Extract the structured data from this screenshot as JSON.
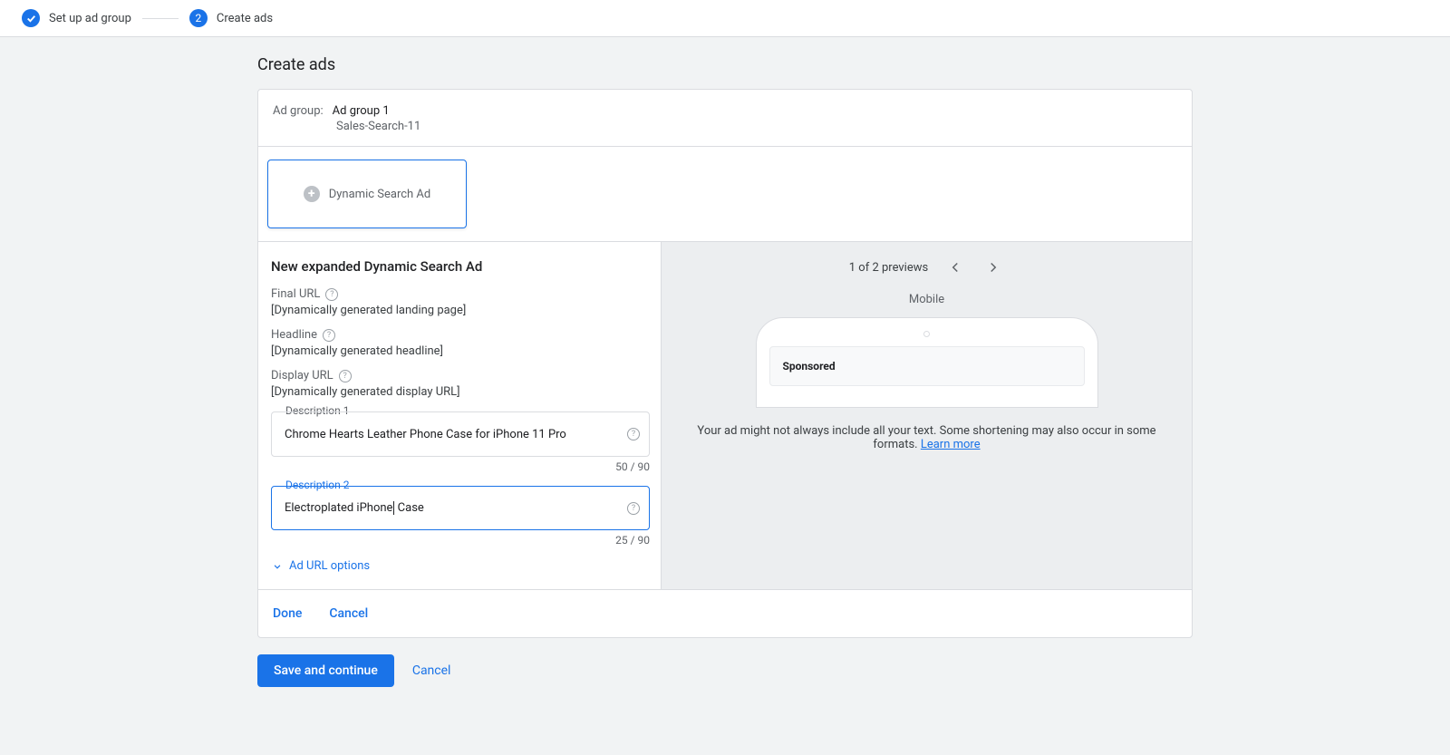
{
  "steps": {
    "step1_label": "Set up ad group",
    "step2_number": "2",
    "step2_label": "Create ads"
  },
  "page": {
    "title": "Create ads"
  },
  "ad_group": {
    "prefix": "Ad group:",
    "name": "Ad group 1",
    "campaign": "Sales-Search-11"
  },
  "ad_tile": {
    "label": "Dynamic Search Ad"
  },
  "editor": {
    "title": "New expanded Dynamic Search Ad",
    "final_url_label": "Final URL",
    "final_url_value": "[Dynamically generated landing page]",
    "headline_label": "Headline",
    "headline_value": "[Dynamically generated headline]",
    "display_url_label": "Display URL",
    "display_url_value": "[Dynamically generated display URL]",
    "desc1_label": "Description 1",
    "desc1_value": "Chrome Hearts Leather Phone Case for iPhone 11 Pro",
    "desc1_count": "50 / 90",
    "desc2_label": "Description 2",
    "desc2_value_before": "Electroplated iPhone",
    "desc2_value_after": " Case",
    "desc2_count": "25 / 90",
    "url_options": "Ad URL options"
  },
  "preview": {
    "counter": "1 of 2 previews",
    "type": "Mobile",
    "sponsored": "Sponsored",
    "note": "Your ad might not always include all your text. Some shortening may also occur in some formats. ",
    "learn_more": "Learn more"
  },
  "actions": {
    "done": "Done",
    "cancel": "Cancel",
    "save_continue": "Save and continue",
    "page_cancel": "Cancel"
  }
}
